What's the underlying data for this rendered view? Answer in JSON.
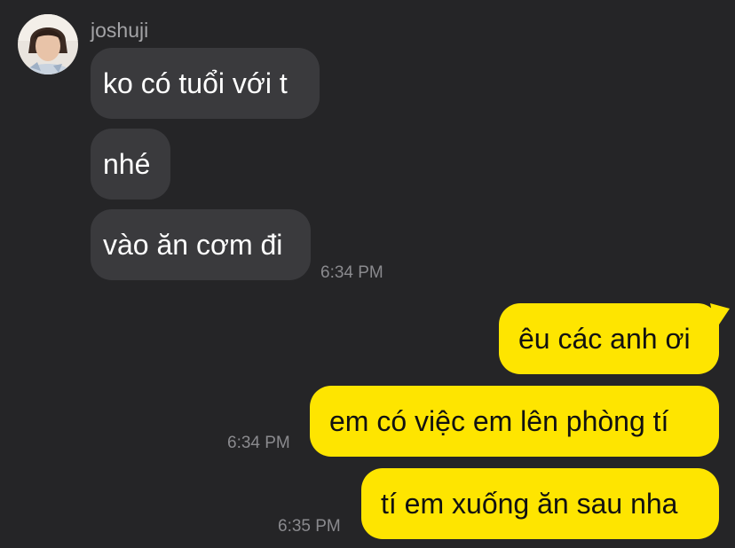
{
  "conversation": {
    "incoming": {
      "sender": "joshuji",
      "avatar_icon": "profile-photo-avatar",
      "messages": [
        {
          "text": "ko có tuổi với t"
        },
        {
          "text": "nhé"
        },
        {
          "text": "vào ăn cơm đi",
          "time": "6:34 PM"
        }
      ]
    },
    "outgoing": {
      "messages": [
        {
          "text": "êu các anh ơi"
        },
        {
          "text": "em có việc em lên phòng tí",
          "time": "6:34 PM"
        },
        {
          "text": "tí em xuống ăn sau nha",
          "time": "6:35 PM"
        }
      ]
    }
  },
  "colors": {
    "background": "#252527",
    "incoming_bubble": "#3a3a3d",
    "outgoing_bubble": "#fee500"
  }
}
